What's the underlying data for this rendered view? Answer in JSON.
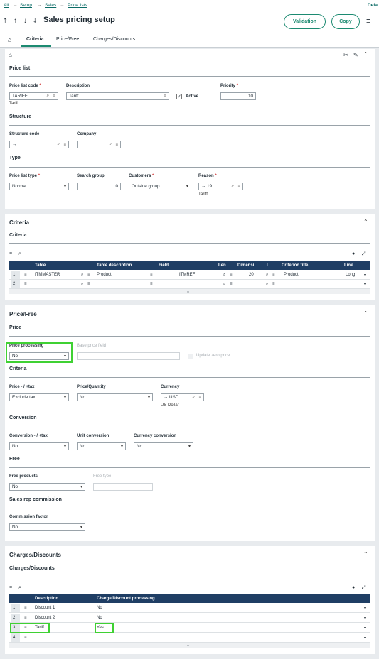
{
  "breadcrumb": {
    "all": "All",
    "setup": "Setup",
    "sales": "Sales",
    "price_lists": "Price lists",
    "sep": "→",
    "right": "Defa"
  },
  "header": {
    "title": "Sales pricing setup",
    "validation": "Validation",
    "copy": "Copy"
  },
  "tabs": [
    "Criteria",
    "Price/Free",
    "Charges/Discounts"
  ],
  "section1": {
    "price_list": "Price list",
    "code_label": "Price list code",
    "code_value": "TARIFF",
    "code_hint": "Tariff",
    "desc_label": "Description",
    "desc_value": "Tariff",
    "active_label": "Active",
    "priority_label": "Priority",
    "priority_value": "10",
    "structure": "Structure",
    "struct_code_label": "Structure code",
    "struct_code_value": "→",
    "company_label": "Company",
    "type": "Type",
    "pl_type_label": "Price list type",
    "pl_type_value": "Normal",
    "search_group_label": "Search group",
    "search_group_value": "0",
    "customers_label": "Customers",
    "customers_value": "Outside group",
    "reason_label": "Reason",
    "reason_value": "→  19",
    "reason_hint": "Tariff"
  },
  "criteria": {
    "title": "Criteria",
    "subtitle": "Criteria",
    "columns": [
      "Table",
      "Table description",
      "Field",
      "Len...",
      "Dimensi...",
      "I...",
      "Criterion title",
      "Link"
    ],
    "rows": [
      [
        "1",
        "ITMMASTER",
        "Product",
        "ITMREF",
        "20",
        "",
        "Product",
        "Long"
      ],
      [
        "2",
        "",
        "",
        "",
        "",
        "",
        "",
        ""
      ]
    ]
  },
  "price_free": {
    "title": "Price/Free",
    "price": "Price",
    "price_processing_label": "Price processing",
    "price_processing_value": "No",
    "base_price_label": "Base price field",
    "update_zero_label": "Update zero price",
    "criteria": "Criteria",
    "price_tax_label": "Price - / +tax",
    "price_tax_value": "Exclude tax",
    "price_qty_label": "Price/Quantity",
    "price_qty_value": "No",
    "currency_label": "Currency",
    "currency_value": "→  USD",
    "currency_hint": "US Dollar",
    "conversion": "Conversion",
    "conv_tax_label": "Conversion - / +tax",
    "conv_tax_value": "No",
    "unit_conv_label": "Unit conversion",
    "unit_conv_value": "No",
    "curr_conv_label": "Currency conversion",
    "curr_conv_value": "No",
    "free": "Free",
    "free_products_label": "Free products",
    "free_products_value": "No",
    "free_type_label": "Free type",
    "sales_rep": "Sales rep commission",
    "commission_label": "Commission factor",
    "commission_value": "No"
  },
  "charges": {
    "title": "Charges/Discounts",
    "subtitle": "Charges/Discounts",
    "columns": [
      "Description",
      "Charge/Discount processing"
    ],
    "rows": [
      [
        "1",
        "Discount 1",
        "No"
      ],
      [
        "2",
        "Discount 2",
        "No"
      ],
      [
        "3",
        "Tariff",
        "Yes"
      ],
      [
        "4",
        "",
        ""
      ]
    ]
  },
  "colors": {
    "accent": "#1c8a71",
    "grid_header": "#1f3e64",
    "highlight": "#3fd133",
    "required": "#d23b3b"
  }
}
